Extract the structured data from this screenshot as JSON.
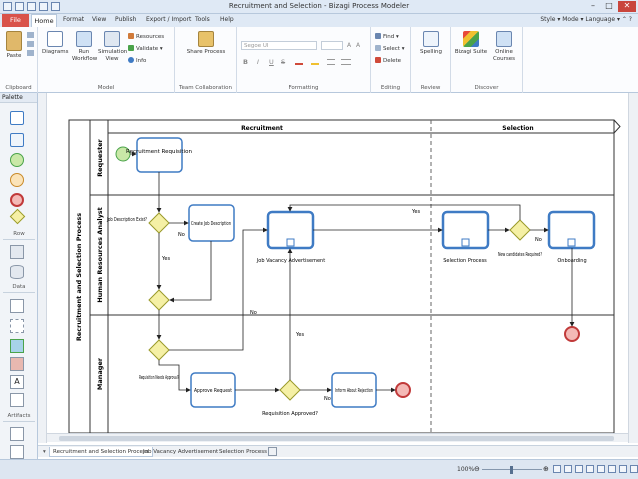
{
  "window": {
    "title": "Recruitment and Selection - Bizagi Process Modeler"
  },
  "menu": {
    "file": "File",
    "home": "Home",
    "format": "Format",
    "view": "View",
    "publish": "Publish",
    "export_import": "Export / Import",
    "tools": "Tools",
    "help": "Help",
    "right": "Style ▾ Mode ▾ Language ▾ ⌃ ?"
  },
  "ribbon": {
    "paste": "Paste",
    "diagrams": "Diagrams",
    "run_workflow": "Run Workflow",
    "simulation_view": "Simulation View",
    "resources": "Resources",
    "validate": "Validate ▾",
    "info": "Info",
    "share_process": "Share Process",
    "font_name": "Segoe UI",
    "find": "Find ▾",
    "select": "Select ▾",
    "delete": "Delete",
    "spelling": "Spelling",
    "bizagi_suite": "Bizagi Suite",
    "online_courses": "Online Courses",
    "groups": {
      "clipboard": "Clipboard",
      "model": "Model",
      "team": "Team Collaboration",
      "formatting": "Formatting",
      "editing": "Editing",
      "review": "Review",
      "discover": "Discover"
    }
  },
  "palette": {
    "title": "Palette",
    "sections": {
      "row": "Row",
      "data": "Data",
      "artifacts": "Artifacts"
    }
  },
  "diagram": {
    "pool": "Recruitment and Selection Process",
    "phases": [
      "Recruitment",
      "Selection"
    ],
    "lanes": [
      "Requester",
      "Human Resources Analyst",
      "Manager"
    ],
    "tasks": {
      "req": "Recruitment Requisition",
      "create_jd": "Create Job Description",
      "jva": "Job Vacancy Advertisement",
      "selection": "Selection Process",
      "onboarding": "Onboarding",
      "approve": "Approve Request",
      "inform": "Inform About Rejection"
    },
    "gateways": {
      "jd_exist": "Job Description Exist?",
      "new_cand": "New candidates Required?",
      "req_needs": "Requisition Needs Approval?",
      "req_approved": "Requisition Approved?"
    },
    "flow_labels": {
      "no": "No",
      "yes": "Yes"
    }
  },
  "tabs": [
    "Recruitment and Selection Process",
    "Job Vacancy Advertisement",
    "Selection Process"
  ],
  "status": {
    "zoom": "100%"
  }
}
